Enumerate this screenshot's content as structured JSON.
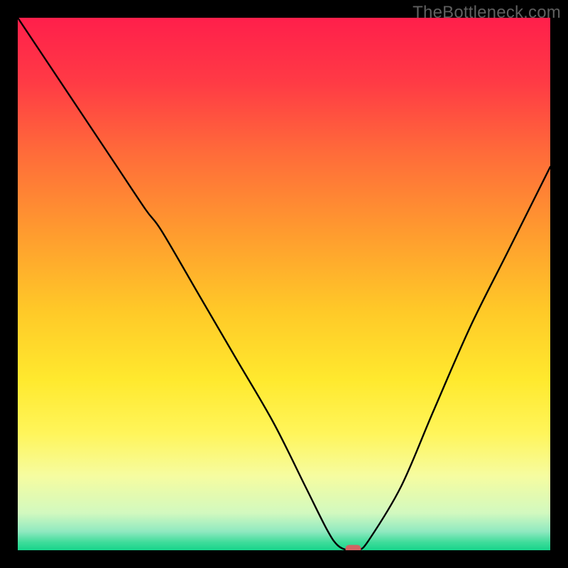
{
  "watermark": "TheBottleneck.com",
  "chart_data": {
    "type": "line",
    "title": "",
    "xlabel": "",
    "ylabel": "",
    "xlim": [
      0,
      100
    ],
    "ylim": [
      0,
      100
    ],
    "background": {
      "type": "vertical-gradient",
      "stops": [
        {
          "offset": 0.0,
          "color": "#ff1f4b"
        },
        {
          "offset": 0.12,
          "color": "#ff3a45"
        },
        {
          "offset": 0.25,
          "color": "#ff6a3a"
        },
        {
          "offset": 0.4,
          "color": "#ff9a2f"
        },
        {
          "offset": 0.55,
          "color": "#ffc928"
        },
        {
          "offset": 0.68,
          "color": "#ffe92e"
        },
        {
          "offset": 0.78,
          "color": "#fff55a"
        },
        {
          "offset": 0.86,
          "color": "#f6fca0"
        },
        {
          "offset": 0.93,
          "color": "#d2f9bf"
        },
        {
          "offset": 0.965,
          "color": "#8fe9c0"
        },
        {
          "offset": 0.985,
          "color": "#3fdc9a"
        },
        {
          "offset": 1.0,
          "color": "#17d48b"
        }
      ]
    },
    "series": [
      {
        "name": "bottleneck-curve",
        "x": [
          0,
          6,
          12,
          18,
          24,
          27,
          34,
          41,
          48,
          54,
          58,
          60,
          62,
          64,
          66,
          72,
          78,
          85,
          92,
          100
        ],
        "y": [
          100,
          91,
          82,
          73,
          64,
          60,
          48,
          36,
          24,
          12,
          4,
          1,
          0,
          0,
          2,
          12,
          26,
          42,
          56,
          72
        ]
      }
    ],
    "marker": {
      "x": 63,
      "y": 0,
      "color": "#d16363"
    }
  }
}
